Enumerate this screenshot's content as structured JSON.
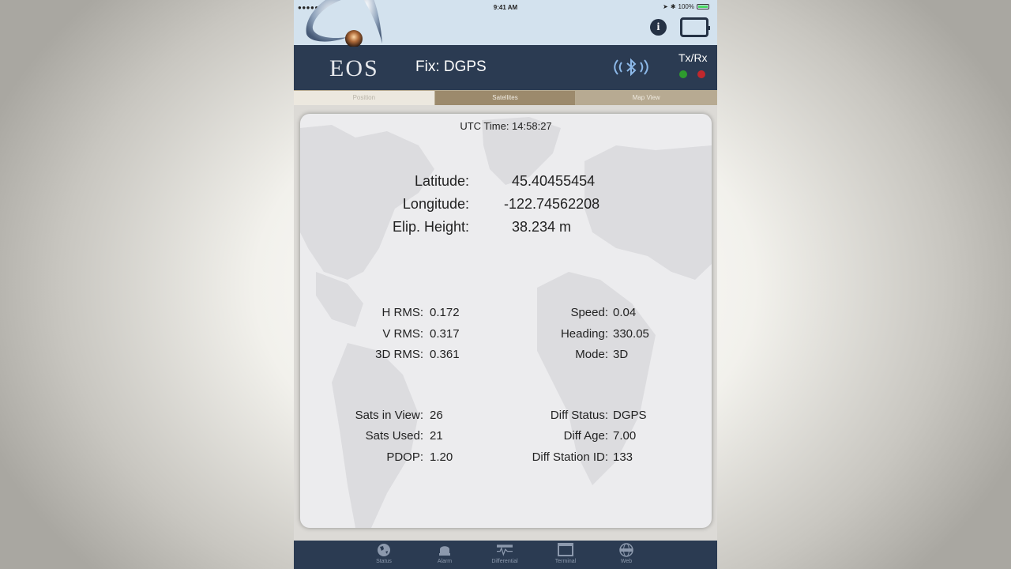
{
  "status_bar": {
    "signal": "●●●●●",
    "time": "9:41 AM",
    "battery": "100%",
    "battery_level": 1.0
  },
  "header": {
    "logo_text": "EOS",
    "fix_label": "Fix: DGPS",
    "txrx_label": "Tx/Rx",
    "tx_led_color": "#2e9b2e",
    "rx_led_color": "#c0282d",
    "header_color": "#2b3b52"
  },
  "tabs": [
    {
      "label": "Position"
    },
    {
      "label": "Satellites"
    },
    {
      "label": "Map View"
    }
  ],
  "position": {
    "utc": "UTC Time: 14:58:27",
    "latitude_label": "Latitude:",
    "latitude_value": "45.40455454",
    "longitude_label": "Longitude:",
    "longitude_value": "-122.74562208",
    "height_label": "Elip. Height:",
    "height_value": "38.234 m",
    "h_rms_label": "H RMS:",
    "h_rms_value": "0.172",
    "v_rms_label": "V RMS:",
    "v_rms_value": "0.317",
    "rms3d_label": "3D RMS:",
    "rms3d_value": "0.361",
    "speed_label": "Speed:",
    "speed_value": "0.04",
    "heading_label": "Heading:",
    "heading_value": "330.05",
    "mode_label": "Mode:",
    "mode_value": "3D",
    "sats_view_label": "Sats in View:",
    "sats_view_value": "26",
    "sats_used_label": "Sats Used:",
    "sats_used_value": "21",
    "pdop_label": "PDOP:",
    "pdop_value": "1.20",
    "diff_status_label": "Diff Status:",
    "diff_status_value": "DGPS",
    "diff_age_label": "Diff Age:",
    "diff_age_value": "7.00",
    "diff_station_label": "Diff Station ID:",
    "diff_station_value": "133"
  },
  "tabbar": [
    {
      "label": "Status",
      "icon": "globe-icon"
    },
    {
      "label": "Alarm",
      "icon": "alarm-icon"
    },
    {
      "label": "Differential",
      "icon": "differential-icon"
    },
    {
      "label": "Terminal",
      "icon": "terminal-icon"
    },
    {
      "label": "Web",
      "icon": "web-icon"
    }
  ]
}
